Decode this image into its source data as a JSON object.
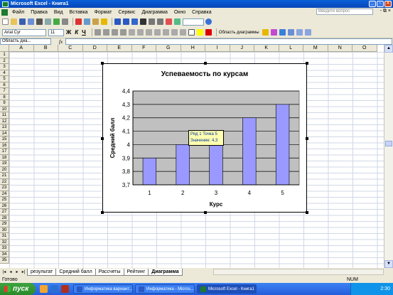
{
  "window": {
    "title": "Microsoft Excel - Книга1"
  },
  "menu": {
    "items": [
      "Файл",
      "Правка",
      "Вид",
      "Вставка",
      "Формат",
      "Сервис",
      "Диаграмма",
      "Окно",
      "Справка"
    ],
    "help_placeholder": "Введите вопрос",
    "doc_controls": "- ⧉ ×"
  },
  "format_toolbar": {
    "font_name": "Arial Cyr",
    "font_size": "11",
    "bold": "Ж",
    "italic": "К",
    "underline": "Ч"
  },
  "chart_toolbar": {
    "selection": "Область диаграммы"
  },
  "formula_bar": {
    "name_box": "Область диа...",
    "fx": "fx",
    "formula": ""
  },
  "columns": [
    "A",
    "B",
    "C",
    "D",
    "E",
    "F",
    "G",
    "H",
    "I",
    "J",
    "K",
    "L",
    "M",
    "N",
    "O"
  ],
  "rows": [
    "1",
    "2",
    "3",
    "4",
    "5",
    "6",
    "7",
    "8",
    "9",
    "10",
    "11",
    "12",
    "13",
    "14",
    "15",
    "16",
    "17",
    "18",
    "19",
    "20",
    "21",
    "22",
    "23",
    "24",
    "25",
    "26",
    "27",
    "28",
    "29",
    "30",
    "31",
    "32",
    "33",
    "34",
    "35"
  ],
  "chart_data": {
    "type": "bar",
    "title": "Успеваемость по курсам",
    "xlabel": "Курс",
    "ylabel": "Средний балл",
    "categories": [
      "1",
      "2",
      "3",
      "4",
      "5"
    ],
    "values": [
      3.9,
      4.0,
      4.1,
      4.2,
      4.3
    ],
    "ylim": [
      3.7,
      4.4
    ],
    "yticks": [
      "3,7",
      "3,8",
      "3,9",
      "4",
      "4,1",
      "4,2",
      "4,3",
      "4,4"
    ],
    "bar_color": "#9999ff",
    "plot_bg": "#c0c0c0",
    "grid": true
  },
  "tooltip": {
    "line1": "Ряд 1 Точка 5",
    "line2": "Значение: 4,3"
  },
  "sheet_tabs": {
    "nav": [
      "|◂",
      "◂",
      "▸",
      "▸|"
    ],
    "tabs": [
      "результат",
      "Средний балл",
      "Рассчеты",
      "Рейтинг",
      "Диаграмма"
    ],
    "active": "Диаграмма"
  },
  "status": {
    "ready": "Готово",
    "num": "NUM"
  },
  "taskbar": {
    "start": "пуск",
    "tasks": [
      "Информатика вариант...",
      "Информатика - Micros...",
      "Microsoft Excel - Книга1"
    ],
    "clock": "2:30"
  }
}
